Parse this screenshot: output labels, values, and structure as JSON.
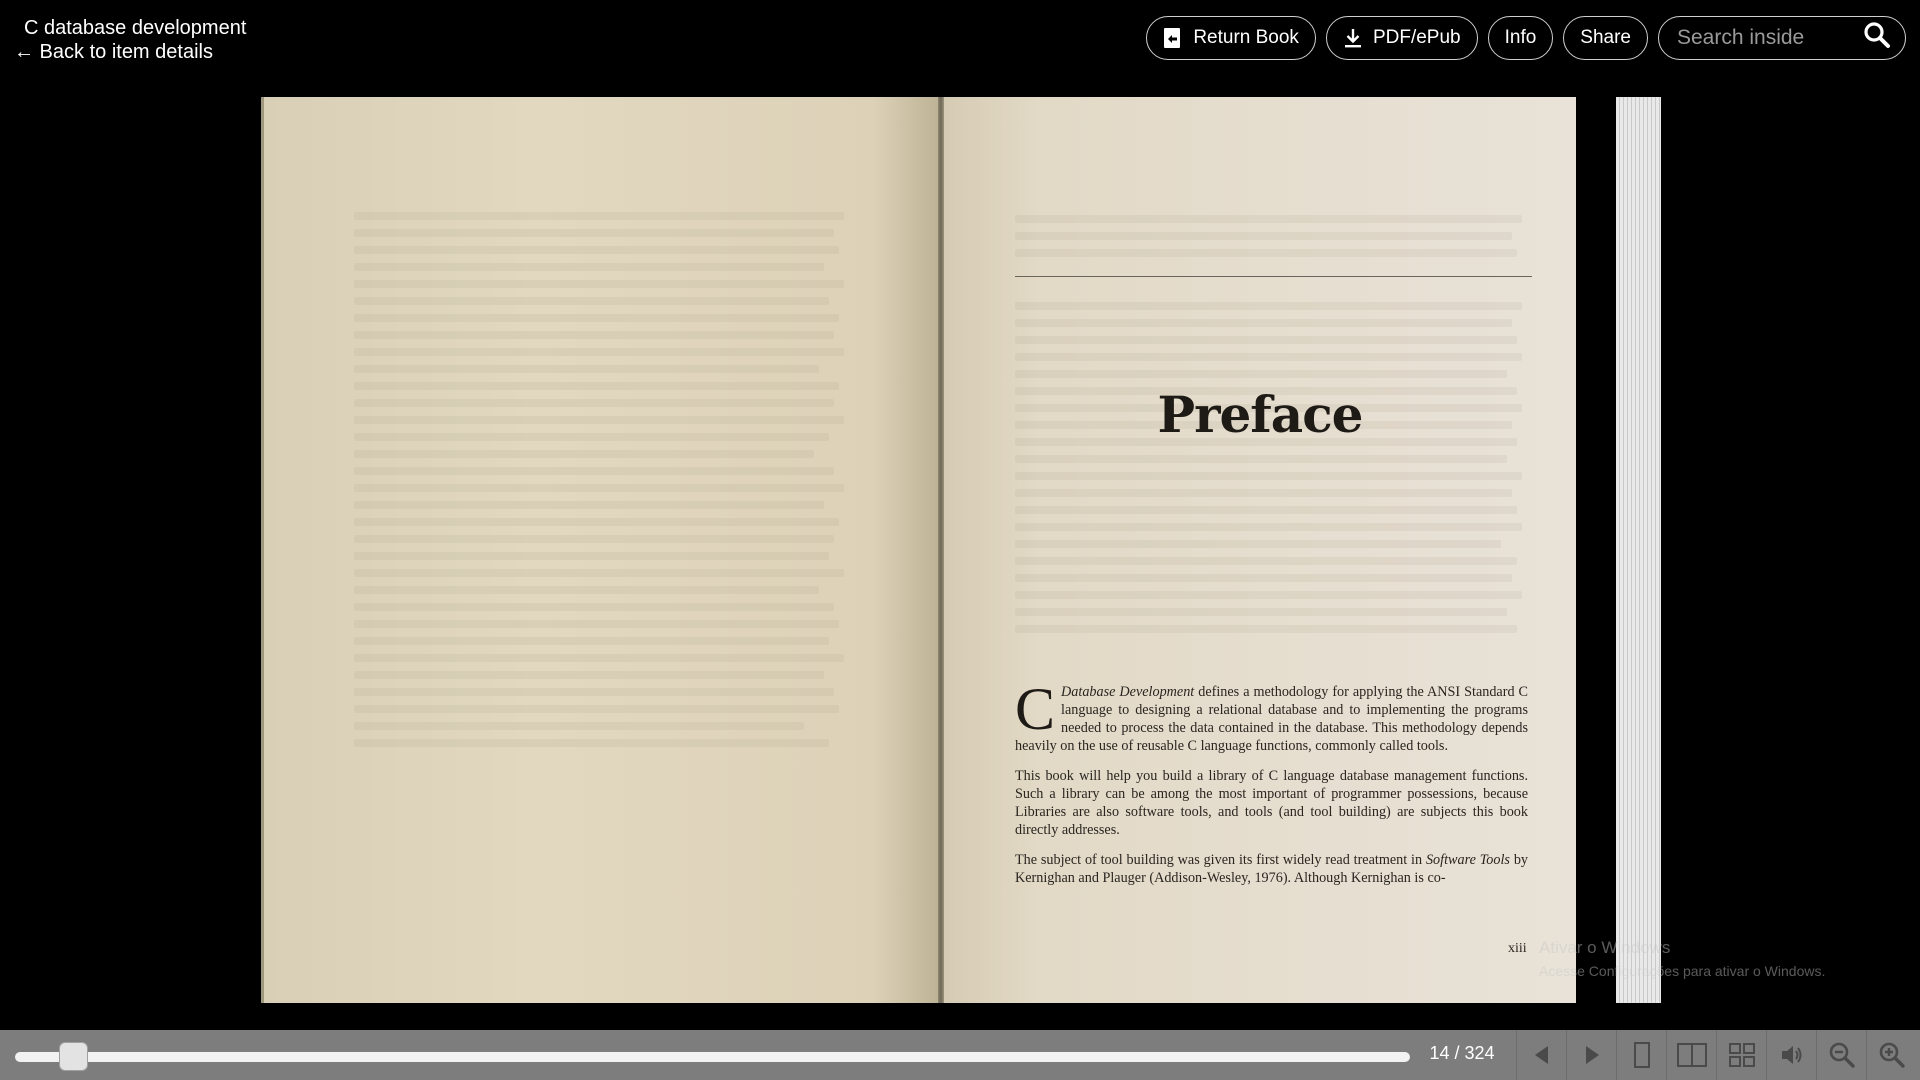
{
  "header": {
    "book_title": "C database development",
    "back_link": "← Back to item details"
  },
  "actions": {
    "return_book": "Return Book",
    "pdf_epub": "PDF/ePub",
    "info": "Info",
    "share": "Share",
    "search_placeholder": "Search inside"
  },
  "page_right": {
    "title": "Preface",
    "dropcap": "C",
    "para1_italic": "Database Development",
    "para1_rest": " defines a methodology for applying the ANSI Standard C language to designing a relational database and to implementing the programs needed to process the data contained in the database. This methodology depends heavily on the use of reusable C language functions, commonly called tools.",
    "para2": "This book will help you build a library of C language database management functions. Such a library can be among the most important of programmer possessions, because Libraries are also software tools, and tools (and tool building) are subjects this book directly addresses.",
    "para3_start": "The subject of tool building was given its first widely read treatment in ",
    "para3_italic": "Software Tools",
    "para3_end": " by Kernighan and Plauger (Addison-Wesley, 1976). Although Kernighan is co-",
    "folio": "xiii"
  },
  "watermark": {
    "line1": "Ativar o Windows",
    "line2": "Acesse Configurações para ativar o Windows."
  },
  "navigation": {
    "current_page": 14,
    "total_pages": 324,
    "page_count_text": "14 / 324",
    "progress_fraction": 0.04
  },
  "controls": [
    "prev-icon",
    "next-icon",
    "one-page-view-icon",
    "two-page-view-icon",
    "thumbnail-view-icon",
    "read-aloud-icon",
    "zoom-out-icon",
    "zoom-in-icon"
  ]
}
